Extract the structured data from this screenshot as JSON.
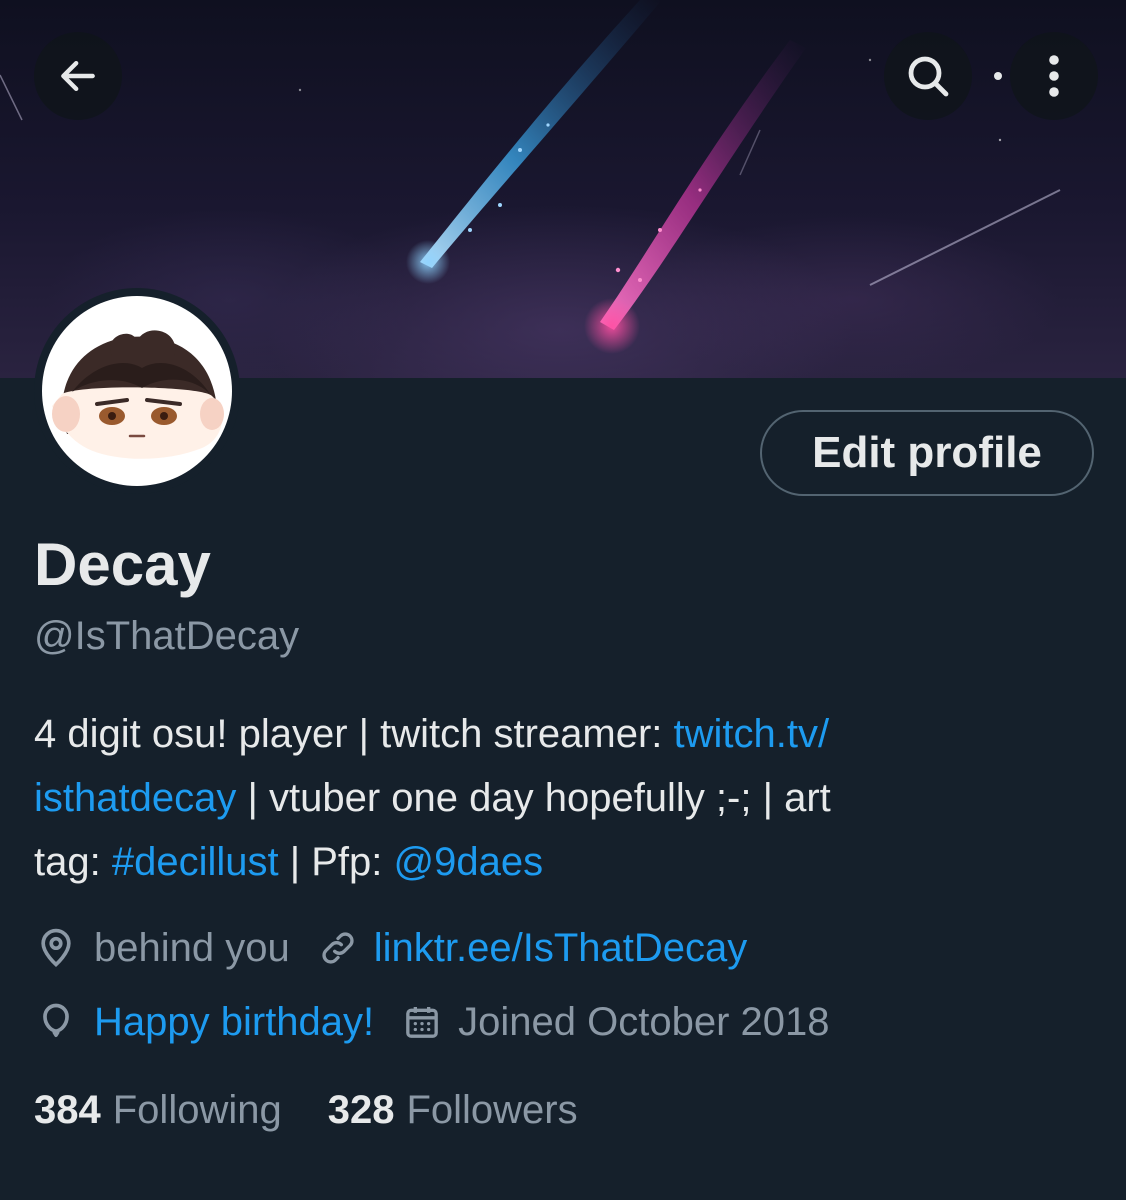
{
  "header": {
    "back_icon": "arrow-left-icon",
    "search_icon": "search-icon",
    "more_icon": "more-vertical-icon"
  },
  "profile": {
    "edit_label": "Edit profile",
    "name": "Decay",
    "handle": "@IsThatDecay",
    "bio": {
      "line1_text": "4 digit osu! player | twitch streamer: ",
      "line1_link": "twitch.tv/",
      "line2_link": "isthatdecay",
      "line2_text": " | vtuber one day hopefully ;-; | art",
      "line3_text_a": "tag: ",
      "line3_hashtag": "#decillust",
      "line3_text_b": " | Pfp: ",
      "line3_mention": "@9daes"
    },
    "location": "behind you",
    "website": "linktr.ee/IsThatDecay",
    "birthday": "Happy birthday!",
    "joined": "Joined October 2018",
    "following_count": "384",
    "following_label": "Following",
    "followers_count": "328",
    "followers_label": "Followers"
  },
  "colors": {
    "background": "#15202b",
    "accent": "#1d9bf0",
    "secondary_text": "#8b98a5",
    "primary_text": "#e7e9ea"
  }
}
